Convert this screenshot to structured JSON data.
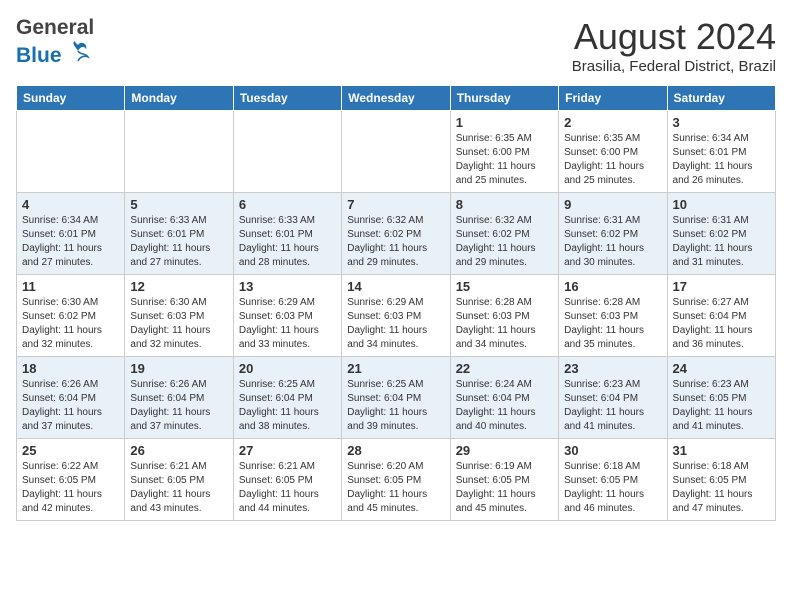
{
  "header": {
    "logo_general": "General",
    "logo_blue": "Blue",
    "month_year": "August 2024",
    "location": "Brasilia, Federal District, Brazil"
  },
  "weekdays": [
    "Sunday",
    "Monday",
    "Tuesday",
    "Wednesday",
    "Thursday",
    "Friday",
    "Saturday"
  ],
  "weeks": [
    [
      {
        "day": "",
        "info": ""
      },
      {
        "day": "",
        "info": ""
      },
      {
        "day": "",
        "info": ""
      },
      {
        "day": "",
        "info": ""
      },
      {
        "day": "1",
        "info": "Sunrise: 6:35 AM\nSunset: 6:00 PM\nDaylight: 11 hours and 25 minutes."
      },
      {
        "day": "2",
        "info": "Sunrise: 6:35 AM\nSunset: 6:00 PM\nDaylight: 11 hours and 25 minutes."
      },
      {
        "day": "3",
        "info": "Sunrise: 6:34 AM\nSunset: 6:01 PM\nDaylight: 11 hours and 26 minutes."
      }
    ],
    [
      {
        "day": "4",
        "info": "Sunrise: 6:34 AM\nSunset: 6:01 PM\nDaylight: 11 hours and 27 minutes."
      },
      {
        "day": "5",
        "info": "Sunrise: 6:33 AM\nSunset: 6:01 PM\nDaylight: 11 hours and 27 minutes."
      },
      {
        "day": "6",
        "info": "Sunrise: 6:33 AM\nSunset: 6:01 PM\nDaylight: 11 hours and 28 minutes."
      },
      {
        "day": "7",
        "info": "Sunrise: 6:32 AM\nSunset: 6:02 PM\nDaylight: 11 hours and 29 minutes."
      },
      {
        "day": "8",
        "info": "Sunrise: 6:32 AM\nSunset: 6:02 PM\nDaylight: 11 hours and 29 minutes."
      },
      {
        "day": "9",
        "info": "Sunrise: 6:31 AM\nSunset: 6:02 PM\nDaylight: 11 hours and 30 minutes."
      },
      {
        "day": "10",
        "info": "Sunrise: 6:31 AM\nSunset: 6:02 PM\nDaylight: 11 hours and 31 minutes."
      }
    ],
    [
      {
        "day": "11",
        "info": "Sunrise: 6:30 AM\nSunset: 6:02 PM\nDaylight: 11 hours and 32 minutes."
      },
      {
        "day": "12",
        "info": "Sunrise: 6:30 AM\nSunset: 6:03 PM\nDaylight: 11 hours and 32 minutes."
      },
      {
        "day": "13",
        "info": "Sunrise: 6:29 AM\nSunset: 6:03 PM\nDaylight: 11 hours and 33 minutes."
      },
      {
        "day": "14",
        "info": "Sunrise: 6:29 AM\nSunset: 6:03 PM\nDaylight: 11 hours and 34 minutes."
      },
      {
        "day": "15",
        "info": "Sunrise: 6:28 AM\nSunset: 6:03 PM\nDaylight: 11 hours and 34 minutes."
      },
      {
        "day": "16",
        "info": "Sunrise: 6:28 AM\nSunset: 6:03 PM\nDaylight: 11 hours and 35 minutes."
      },
      {
        "day": "17",
        "info": "Sunrise: 6:27 AM\nSunset: 6:04 PM\nDaylight: 11 hours and 36 minutes."
      }
    ],
    [
      {
        "day": "18",
        "info": "Sunrise: 6:26 AM\nSunset: 6:04 PM\nDaylight: 11 hours and 37 minutes."
      },
      {
        "day": "19",
        "info": "Sunrise: 6:26 AM\nSunset: 6:04 PM\nDaylight: 11 hours and 37 minutes."
      },
      {
        "day": "20",
        "info": "Sunrise: 6:25 AM\nSunset: 6:04 PM\nDaylight: 11 hours and 38 minutes."
      },
      {
        "day": "21",
        "info": "Sunrise: 6:25 AM\nSunset: 6:04 PM\nDaylight: 11 hours and 39 minutes."
      },
      {
        "day": "22",
        "info": "Sunrise: 6:24 AM\nSunset: 6:04 PM\nDaylight: 11 hours and 40 minutes."
      },
      {
        "day": "23",
        "info": "Sunrise: 6:23 AM\nSunset: 6:04 PM\nDaylight: 11 hours and 41 minutes."
      },
      {
        "day": "24",
        "info": "Sunrise: 6:23 AM\nSunset: 6:05 PM\nDaylight: 11 hours and 41 minutes."
      }
    ],
    [
      {
        "day": "25",
        "info": "Sunrise: 6:22 AM\nSunset: 6:05 PM\nDaylight: 11 hours and 42 minutes."
      },
      {
        "day": "26",
        "info": "Sunrise: 6:21 AM\nSunset: 6:05 PM\nDaylight: 11 hours and 43 minutes."
      },
      {
        "day": "27",
        "info": "Sunrise: 6:21 AM\nSunset: 6:05 PM\nDaylight: 11 hours and 44 minutes."
      },
      {
        "day": "28",
        "info": "Sunrise: 6:20 AM\nSunset: 6:05 PM\nDaylight: 11 hours and 45 minutes."
      },
      {
        "day": "29",
        "info": "Sunrise: 6:19 AM\nSunset: 6:05 PM\nDaylight: 11 hours and 45 minutes."
      },
      {
        "day": "30",
        "info": "Sunrise: 6:18 AM\nSunset: 6:05 PM\nDaylight: 11 hours and 46 minutes."
      },
      {
        "day": "31",
        "info": "Sunrise: 6:18 AM\nSunset: 6:05 PM\nDaylight: 11 hours and 47 minutes."
      }
    ]
  ]
}
